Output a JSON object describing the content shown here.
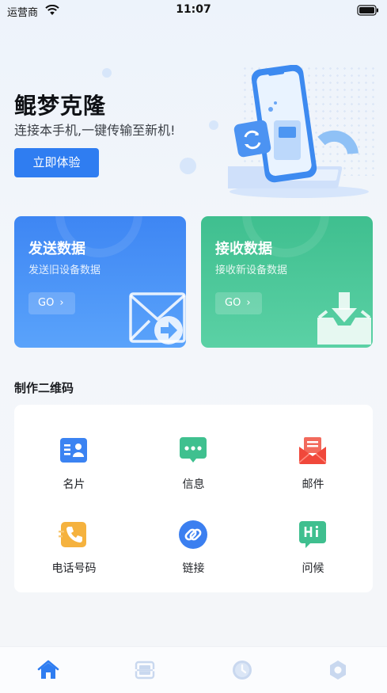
{
  "status_bar": {
    "carrier": "运营商",
    "time": "11:07"
  },
  "banner": {
    "title": "鲲梦克隆",
    "subtitle": "连接本手机,一键传输至新机!",
    "cta_label": "立即体验"
  },
  "cards": {
    "send": {
      "title": "发送数据",
      "desc": "发送旧设备数据",
      "go_label": "GO"
    },
    "receive": {
      "title": "接收数据",
      "desc": "接收新设备数据",
      "go_label": "GO"
    }
  },
  "qr_section": {
    "title": "制作二维码",
    "items": [
      {
        "label": "名片",
        "icon": "business-card-icon"
      },
      {
        "label": "信息",
        "icon": "message-icon"
      },
      {
        "label": "邮件",
        "icon": "mail-icon"
      },
      {
        "label": "电话号码",
        "icon": "phone-icon"
      },
      {
        "label": "链接",
        "icon": "link-icon"
      },
      {
        "label": "问候",
        "icon": "greeting-icon"
      }
    ]
  },
  "tab_bar": {
    "tabs": [
      {
        "icon": "home-icon",
        "active": true
      },
      {
        "icon": "scan-icon",
        "active": false
      },
      {
        "icon": "clock-icon",
        "active": false
      },
      {
        "icon": "settings-icon",
        "active": false
      }
    ]
  },
  "colors": {
    "primary": "#2f7df1",
    "send_card": "#3e86f3",
    "receive_card": "#3fbf8f",
    "tab_active": "#2f7df1",
    "tab_inactive": "#c9d8ef"
  }
}
